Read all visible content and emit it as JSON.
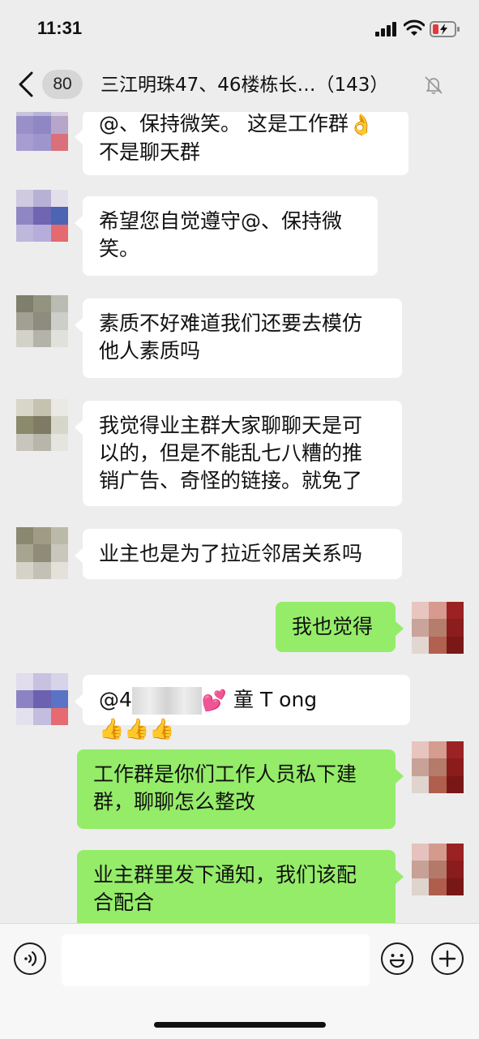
{
  "status_bar": {
    "time": "11:31"
  },
  "header": {
    "back_label": "<",
    "unread_count": "80",
    "group_title": "三江明珠47、46楼栋长…（143）",
    "muted_icon": "bell-muted-icon"
  },
  "messages": [
    {
      "side": "left",
      "lines": [
        "@、保持微笑。 这是工作群",
        "不是聊天群"
      ],
      "emoji": "👌"
    },
    {
      "side": "left",
      "lines": [
        "希望您自觉遵守@、保持微",
        "笑。"
      ]
    },
    {
      "side": "left",
      "lines": [
        "素质不好难道我们还要去模仿",
        "他人素质吗"
      ]
    },
    {
      "side": "left",
      "lines": [
        "我觉得业主群大家聊聊天是可",
        "以的，但是不能乱七八糟的推",
        "销广告、奇怪的链接。就免了"
      ]
    },
    {
      "side": "left",
      "lines": [
        "业主也是为了拉近邻居关系吗"
      ]
    },
    {
      "side": "right",
      "lines": [
        "我也觉得"
      ]
    },
    {
      "side": "left",
      "prefix": "@4",
      "suffix": "童 T ong",
      "emoji_heart": "💕",
      "emoji_thumbs": "👍👍👍"
    },
    {
      "side": "right",
      "lines": [
        "工作群是你们工作人员私下建",
        "群，聊聊怎么整改"
      ]
    },
    {
      "side": "right",
      "lines": [
        "业主群里发下通知，我们该配",
        "合配合"
      ]
    }
  ],
  "input_bar": {
    "voice_icon": "voice-icon",
    "emoji_icon": "emoji-icon",
    "plus_icon": "plus-icon",
    "text_value": ""
  },
  "colors": {
    "background": "#EDEDED",
    "own_bubble": "#95EC69",
    "other_bubble": "#FFFFFF"
  }
}
